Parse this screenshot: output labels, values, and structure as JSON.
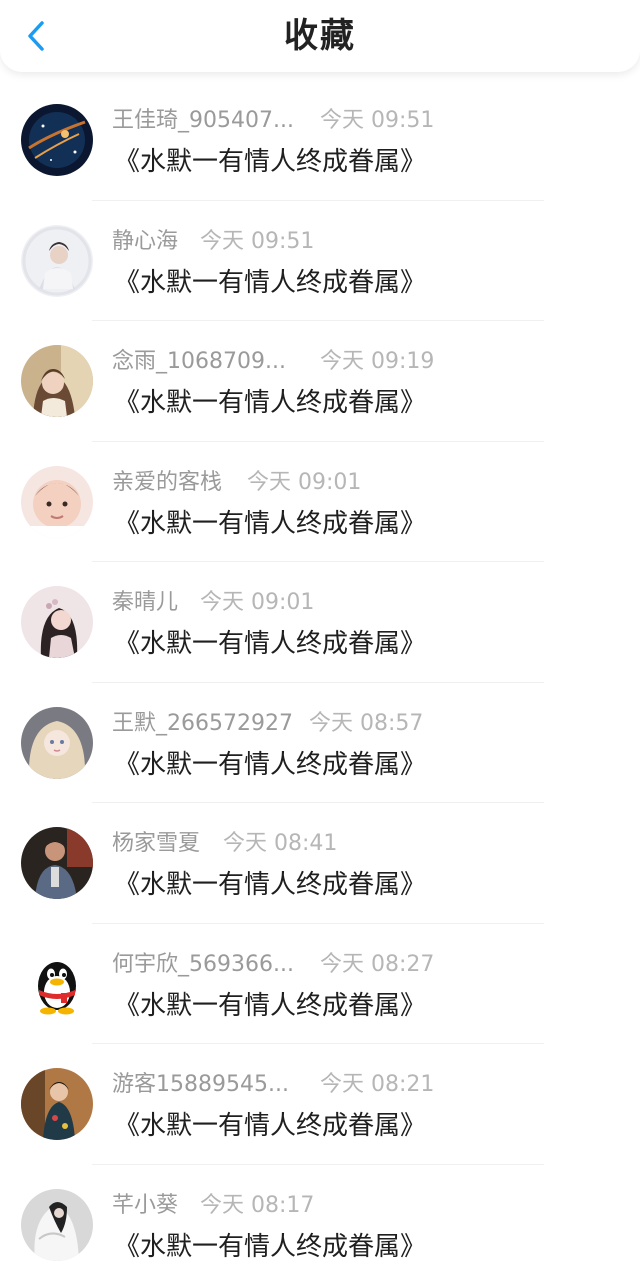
{
  "header": {
    "title": "收藏",
    "back_icon": "chevron-left-icon",
    "accent_color": "#1a9cf3"
  },
  "items": [
    {
      "name": "王佳琦_905407...",
      "time": "今天 09:51",
      "message": "《水默一有情人终成眷属》",
      "avatar": "galaxy-avatar"
    },
    {
      "name": "静心海",
      "time": "今天 09:51",
      "message": "《水默一有情人终成眷属》",
      "avatar": "bride-avatar"
    },
    {
      "name": "念雨_1068709...",
      "time": "今天 09:19",
      "message": "《水默一有情人终成眷属》",
      "avatar": "girl-avatar"
    },
    {
      "name": "亲爱的客栈",
      "time": "今天 09:01",
      "message": "《水默一有情人终成眷属》",
      "avatar": "baby-avatar"
    },
    {
      "name": "秦晴儿",
      "time": "今天 09:01",
      "message": "《水默一有情人终成眷属》",
      "avatar": "girl-profile-avatar"
    },
    {
      "name": "王默_266572927",
      "time": "今天 08:57",
      "message": "《水默一有情人终成眷属》",
      "avatar": "doll-avatar"
    },
    {
      "name": "杨家雪夏",
      "time": "今天 08:41",
      "message": "《水默一有情人终成眷属》",
      "avatar": "man-avatar"
    },
    {
      "name": "何宇欣_569366...",
      "time": "今天 08:27",
      "message": "《水默一有情人终成眷属》",
      "avatar": "penguin-avatar"
    },
    {
      "name": "游客15889545...",
      "time": "今天 08:21",
      "message": "《水默一有情人终成眷属》",
      "avatar": "woman-avatar"
    },
    {
      "name": "芊小葵",
      "time": "今天 08:17",
      "message": "《水默一有情人终成眷属》",
      "avatar": "white-dress-avatar"
    }
  ]
}
